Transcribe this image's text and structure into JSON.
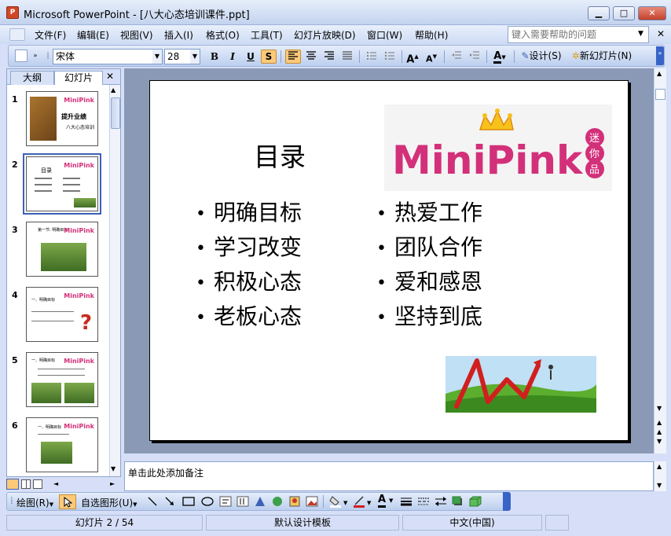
{
  "window": {
    "title": "Microsoft PowerPoint - [八大心态培训课件.ppt]",
    "app_icon_text": "P",
    "minimize": "▁",
    "maximize": "□",
    "close": "✕"
  },
  "menu": {
    "items": [
      "文件(F)",
      "编辑(E)",
      "视图(V)",
      "插入(I)",
      "格式(O)",
      "工具(T)",
      "幻灯片放映(D)",
      "窗口(W)",
      "帮助(H)"
    ],
    "help_placeholder": "键入需要帮助的问题",
    "close_doc": "✕"
  },
  "toolbar": {
    "font_name": "宋体",
    "font_size": "28",
    "bold": "B",
    "italic": "I",
    "underline": "U",
    "shadow": "S",
    "design_label": "设计(S)",
    "new_slide_label": "新幻灯片(N)",
    "font_grow": "A",
    "font_shrink": "A",
    "font_color": "A"
  },
  "left_panel": {
    "tab_outline": "大纲",
    "tab_slides": "幻灯片",
    "close": "✕",
    "thumbnails": [
      {
        "num": "1",
        "lines": [
          "提升业绩",
          "八大心态培训"
        ]
      },
      {
        "num": "2",
        "lines": [
          "目录"
        ]
      },
      {
        "num": "3",
        "lines": [
          "第一节: 明确目标"
        ]
      },
      {
        "num": "4",
        "lines": [
          "一、明确目标"
        ]
      },
      {
        "num": "5",
        "lines": [
          "一、明确目标"
        ]
      },
      {
        "num": "6",
        "lines": [
          "一、明确目标"
        ]
      }
    ],
    "thumb_logo": "MiniPink"
  },
  "slide": {
    "title": "目录",
    "left_bullets": [
      "明确目标",
      "学习改变",
      "积极心态",
      "老板心态"
    ],
    "right_bullets": [
      "热爱工作",
      "团队合作",
      "爱和感恩",
      "坚持到底"
    ],
    "logo_text": "MiniPink",
    "logo_badge": [
      "迷",
      "你",
      "品"
    ]
  },
  "notes": {
    "placeholder": "单击此处添加备注"
  },
  "draw_toolbar": {
    "draw_label": "绘图(R)",
    "autoshapes_label": "自选图形(U)"
  },
  "status": {
    "slide_info": "幻灯片 2 / 54",
    "template": "默认设计模板",
    "language": "中文(中国)"
  },
  "colors": {
    "accent": "#3d62b5",
    "logo_pink": "#d3307a",
    "logo_orange": "#f08a1c",
    "logo_blue": "#2e86c9",
    "logo_green": "#4da33a"
  }
}
